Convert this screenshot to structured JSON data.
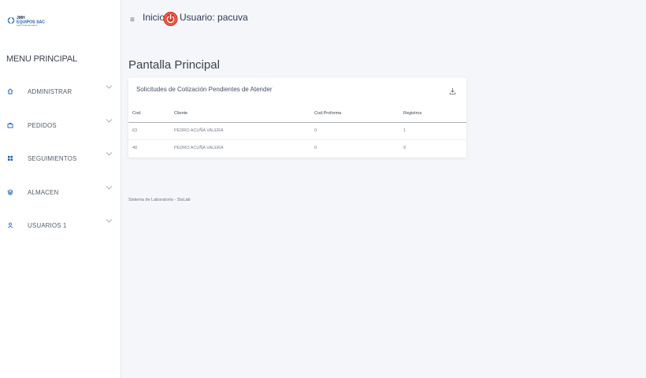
{
  "logo": {
    "line1": "JMH",
    "line2": "EQUIPOS SAC",
    "line3": "INSPECTORES ASOCIADOS"
  },
  "sidebar": {
    "title": "MENU PRINCIPAL",
    "items": [
      {
        "label": "ADMINISTRAR",
        "icon": "home-icon"
      },
      {
        "label": "PEDIDOS",
        "icon": "briefcase-icon"
      },
      {
        "label": "SEGUIMIENTOS",
        "icon": "grid-icon"
      },
      {
        "label": "ALMACEN",
        "icon": "layers-icon"
      },
      {
        "label": "USUARIOS 1",
        "icon": "user-icon"
      }
    ]
  },
  "topbar": {
    "menu_icon": "hamburger-icon",
    "inicio": "Inicio",
    "user": "Usuario: pacuva"
  },
  "main": {
    "title": "Pantalla Principal",
    "card": {
      "title": "Solicitudes de Cotización Pendientes de Atender",
      "columns": [
        "Cod.",
        "Cliente",
        "Cod.Proforma",
        "Registros"
      ],
      "rows": [
        [
          "63",
          "PEDRO ACUÑA VALERA",
          "0",
          "1"
        ],
        [
          "48",
          "PEDRO ACUÑA VALERA",
          "0",
          "9"
        ]
      ]
    },
    "footer": "Sistema de Laboratorio - SisLab"
  },
  "colors": {
    "accent": "#1f5fa8",
    "power": "#d9331c",
    "text_dark": "#2d3b55"
  }
}
